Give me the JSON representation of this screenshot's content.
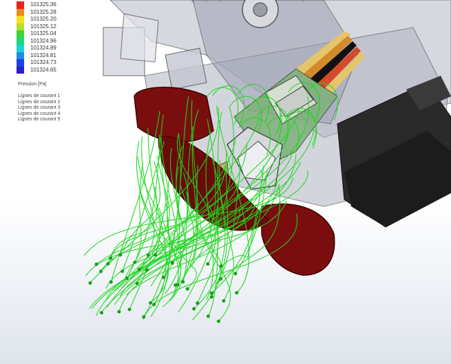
{
  "legend": {
    "title": "Pression [Pa]",
    "items": [
      {
        "value": "101325.36",
        "color": "#e8231f"
      },
      {
        "value": "101325.28",
        "color": "#f08a1c"
      },
      {
        "value": "101325.20",
        "color": "#f5e11f"
      },
      {
        "value": "101325.12",
        "color": "#b8e02a"
      },
      {
        "value": "101325.04",
        "color": "#3ed63a"
      },
      {
        "value": "101324.96",
        "color": "#1fd67a"
      },
      {
        "value": "101324.89",
        "color": "#1fd0d6"
      },
      {
        "value": "101324.81",
        "color": "#1f8ae0"
      },
      {
        "value": "101324.73",
        "color": "#1f3fe0"
      },
      {
        "value": "101324.65",
        "color": "#2a1fc0"
      }
    ]
  },
  "streamlines": {
    "items": [
      "Lignes de courant 1",
      "Lignes de courant 2",
      "Lignes de courant 3",
      "Lignes de courant 4",
      "Lignes de courant 5"
    ],
    "color": "#1fd61f"
  },
  "colors": {
    "heater_block": "#7a0e0e",
    "frame_gray": "#b8bcc8",
    "motor_dark": "#2a2a2a",
    "pcb_green": "#7fb07a"
  }
}
